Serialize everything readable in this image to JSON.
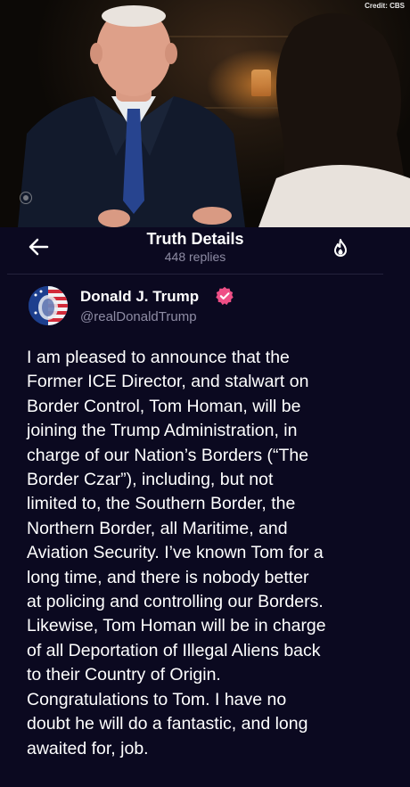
{
  "photo": {
    "credit": "Credit: CBS"
  },
  "header": {
    "title": "Truth Details",
    "replies": "448 replies"
  },
  "post": {
    "author_name": "Donald J. Trump",
    "handle": "@realDonaldTrump",
    "text": "I am pleased to announce that the\nFormer ICE Director, and stalwart on\nBorder Control, Tom Homan, will be\njoining the Trump Administration, in\ncharge of our Nation’s Borders (“The\nBorder Czar”), including, but not\nlimited to, the Southern Border, the\nNorthern Border, all Maritime, and\nAviation Security. I’ve known Tom for a\nlong time, and there is nobody better\nat policing and controlling our Borders.\nLikewise, Tom Homan will be in charge\nof all Deportation of Illegal Aliens back\nto their Country of Origin.\nCongratulations to Tom. I have no\ndoubt he will do a fantastic, and long\nawaited for, job."
  },
  "colors": {
    "background": "#0b0920",
    "verified_badge": "#ee4f86",
    "muted_text": "#8e8ca4"
  },
  "icons": {
    "back": "arrow-left-icon",
    "trending": "flame-icon",
    "verified": "verified-badge-icon"
  }
}
